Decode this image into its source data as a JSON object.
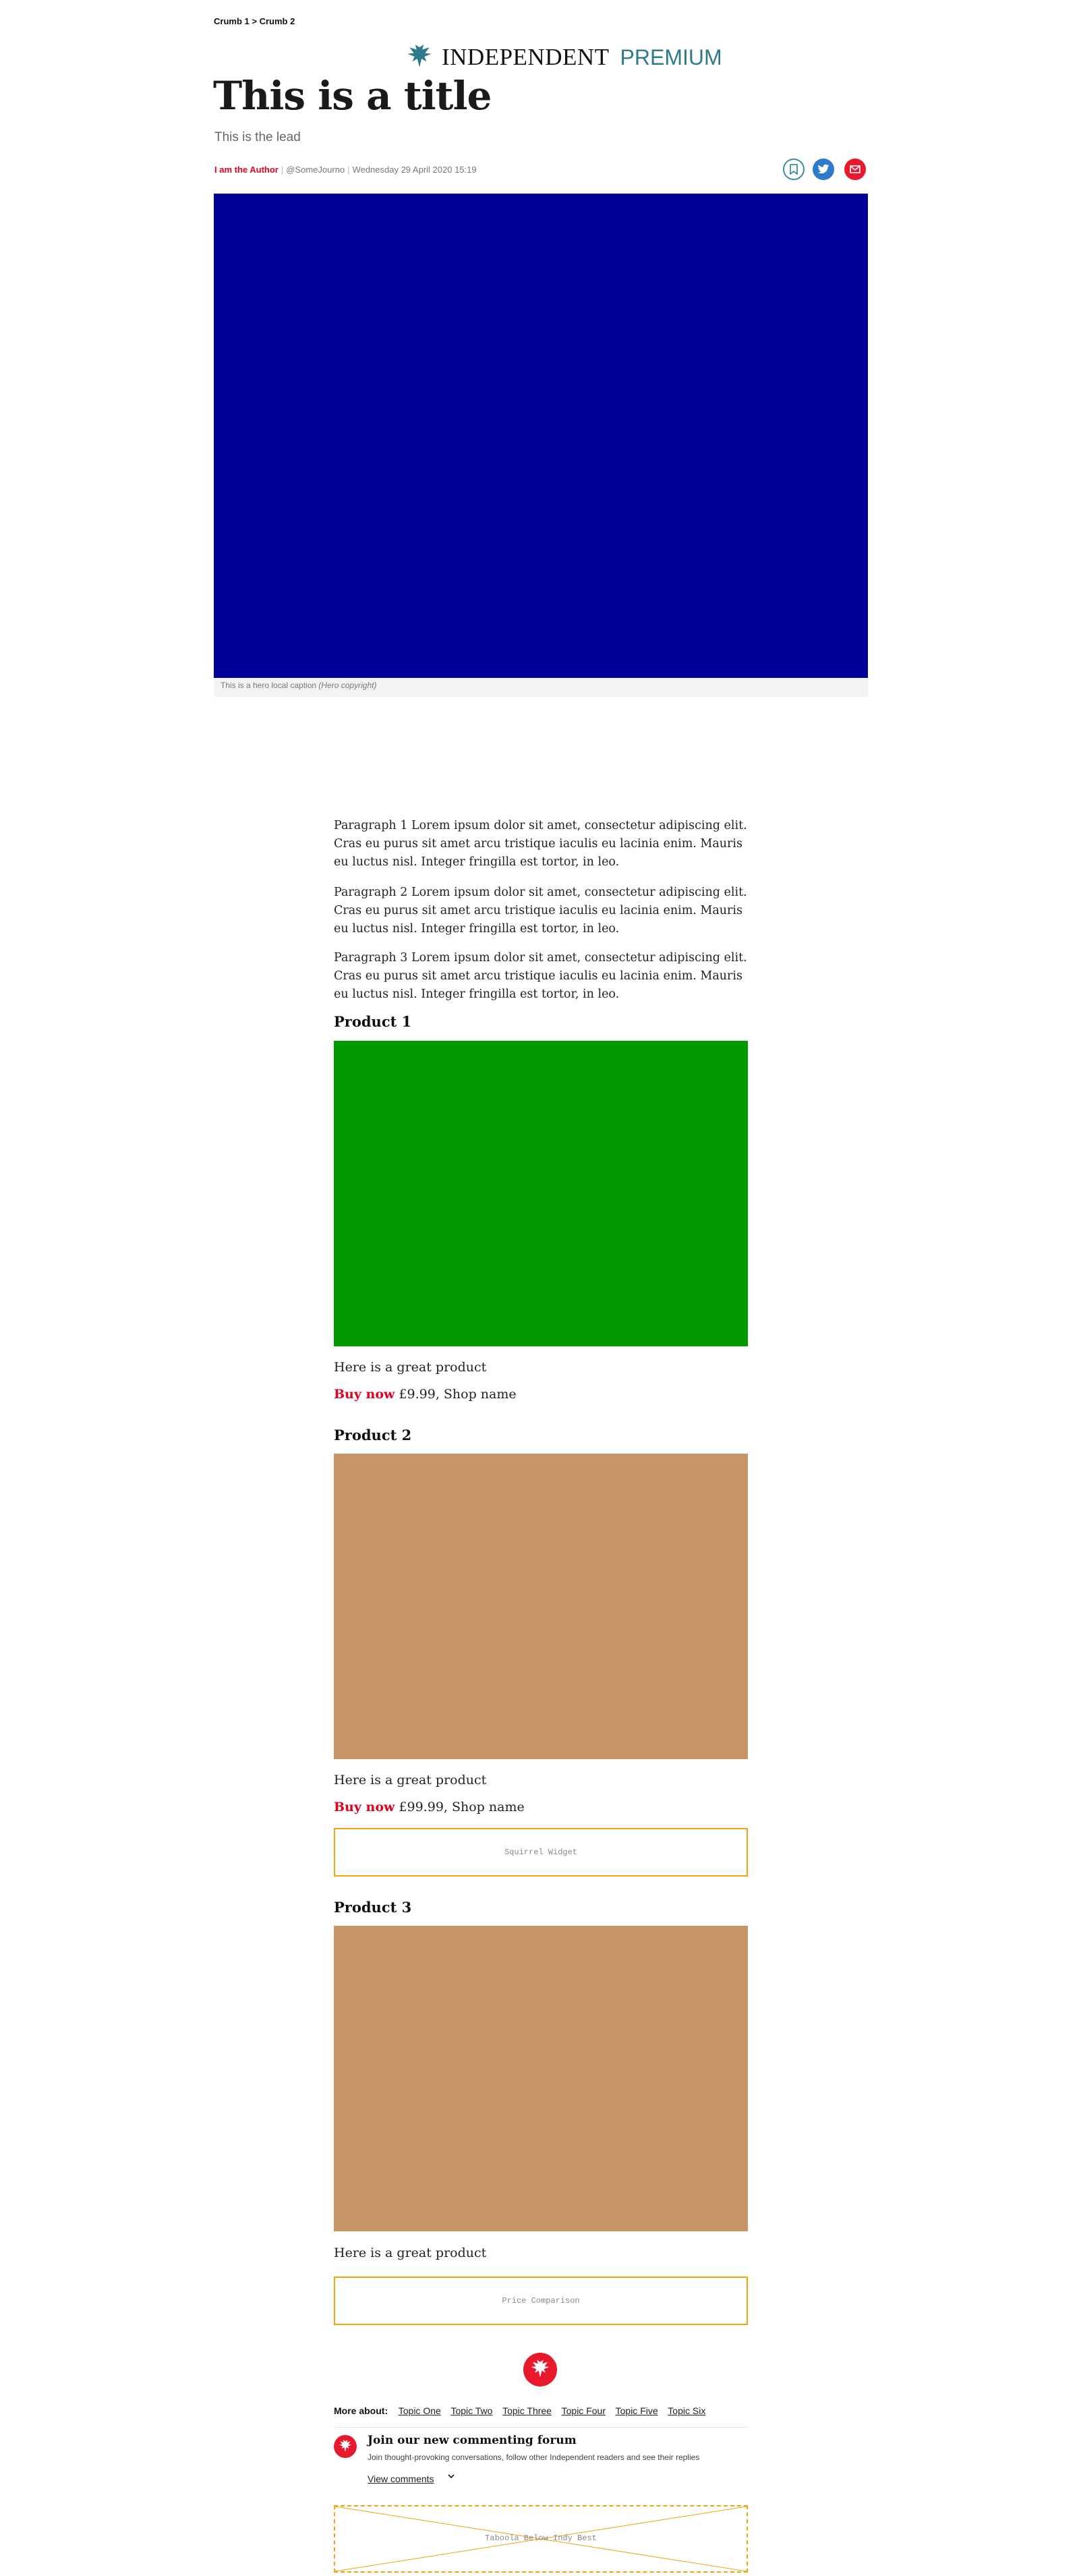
{
  "breadcrumb": {
    "crumb1": "Crumb 1",
    "sep": " > ",
    "crumb2": "Crumb 2"
  },
  "masthead": {
    "brand": "INDEPENDENT",
    "tier": "PREMIUM"
  },
  "article": {
    "title": "This is a title",
    "lead": "This is the lead",
    "author": "I am the Author",
    "handle": "@SomeJourno",
    "date": "Wednesday 29 April 2020 15:19",
    "separator": "|"
  },
  "hero": {
    "caption": "This is a hero local caption",
    "copyright": "(Hero copyright)",
    "color": "#000099"
  },
  "paragraphs": [
    "Paragraph 1 Lorem ipsum dolor sit amet, consectetur adipiscing elit. Cras eu purus sit amet arcu tristique iaculis eu lacinia enim. Mauris eu luctus nisl. Integer fringilla est tortor, in leo.",
    "Paragraph 2 Lorem ipsum dolor sit amet, consectetur adipiscing elit. Cras eu purus sit amet arcu tristique iaculis eu lacinia enim. Mauris eu luctus nisl. Integer fringilla est tortor, in leo.",
    "Paragraph 3 Lorem ipsum dolor sit amet, consectetur adipiscing elit. Cras eu purus sit amet arcu tristique iaculis eu lacinia enim. Mauris eu luctus nisl. Integer fringilla est tortor, in leo."
  ],
  "products": [
    {
      "heading": "Product 1",
      "color": "#009900",
      "desc": "Here is a great product",
      "buy": "Buy now",
      "price": "£9.99, Shop name"
    },
    {
      "heading": "Product 2",
      "color": "#c89566",
      "desc": "Here is a great product",
      "buy": "Buy now",
      "price": "£99.99, Shop name"
    },
    {
      "heading": "Product 3",
      "color": "#c89566",
      "desc": "Here is a great product"
    }
  ],
  "widgets": {
    "squirrel": "Squirrel Widget",
    "price_comparison": "Price Comparison",
    "taboola": "Taboola Below Indy Best"
  },
  "more_about": {
    "label": "More about:",
    "topics": [
      "Topic One",
      "Topic Two",
      "Topic Three",
      "Topic Four",
      "Topic Five",
      "Topic Six"
    ]
  },
  "comments": {
    "title": "Join our new commenting forum",
    "subtitle": "Join thought-provoking conversations, follow other Independent readers and see their replies",
    "view": "View comments"
  },
  "colors": {
    "accent_red": "#e00020",
    "teal": "#2f7a8a",
    "widget_border": "#f0a30a"
  },
  "icons": {
    "logo": "eagle-icon",
    "bookmark": "bookmark-icon",
    "twitter": "twitter-icon",
    "email": "email-icon",
    "chevron": "chevron-down-icon"
  }
}
